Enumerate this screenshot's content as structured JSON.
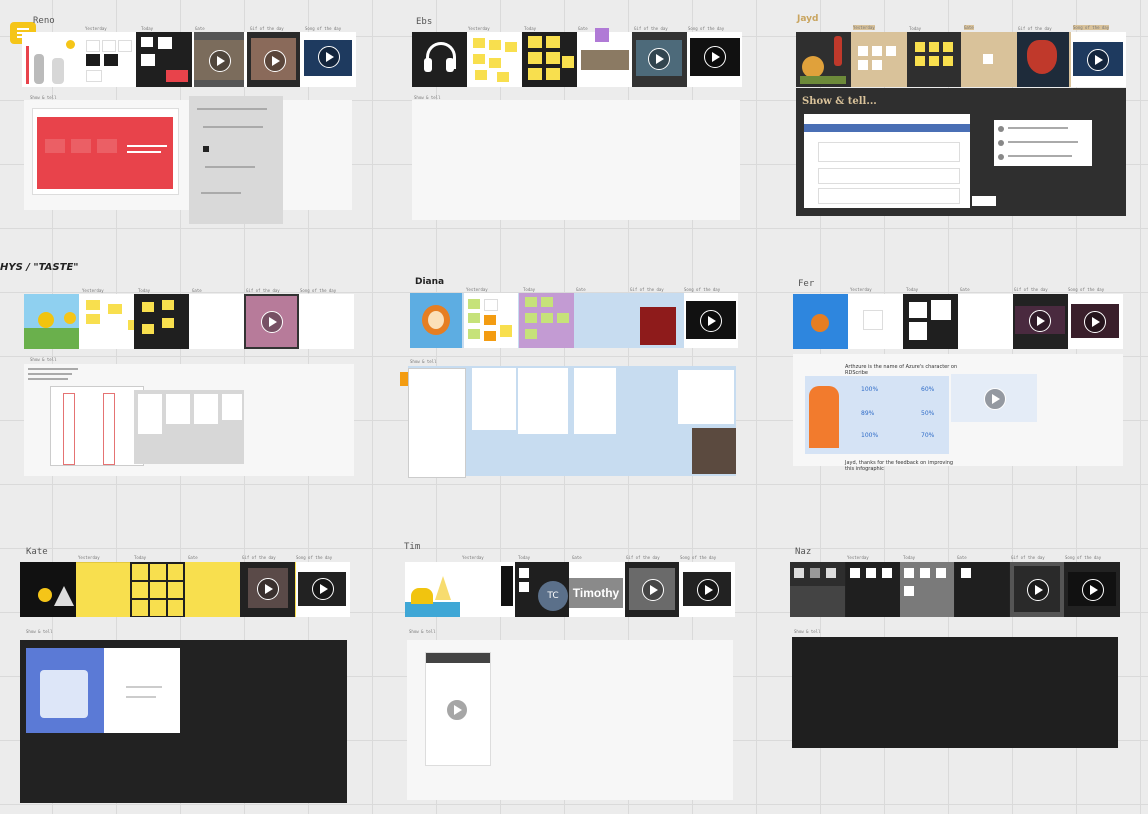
{
  "app": {
    "menu_icon": "comment-menu-icon"
  },
  "col_labels": {
    "yesterday": "Yesterday",
    "today": "Today",
    "gate": "Gate",
    "gif": "Gif of the day",
    "song": "Song of the day",
    "show_tell": "Show & tell"
  },
  "boards": {
    "reno": {
      "name": "Reno"
    },
    "ebs": {
      "name": "Ebs"
    },
    "jayd": {
      "name": "Jayd",
      "show_heading": "Show & tell..."
    },
    "phys": {
      "name": "HYS / \"TASTE\""
    },
    "diana": {
      "name": "Diana"
    },
    "fer": {
      "name": "Fer",
      "note1": "Arthzure is the name of Azure's character on RDScribe",
      "note2": "Jayd, thanks for the feedback on improving this infographic",
      "stats": [
        "100%",
        "60%",
        "89%",
        "50%",
        "100%",
        "70%"
      ]
    },
    "kate": {
      "name": "Kate"
    },
    "tim": {
      "name": "Tim",
      "avatar_initials": "TC",
      "avatar_name": "Timothy"
    },
    "naz": {
      "name": "Naz"
    }
  },
  "colors": {
    "accent_yellow": "#f8df4e",
    "jayd_tan": "#d9c29a",
    "diana_blue": "#c7dcf0",
    "reno_red": "#e8434b"
  }
}
